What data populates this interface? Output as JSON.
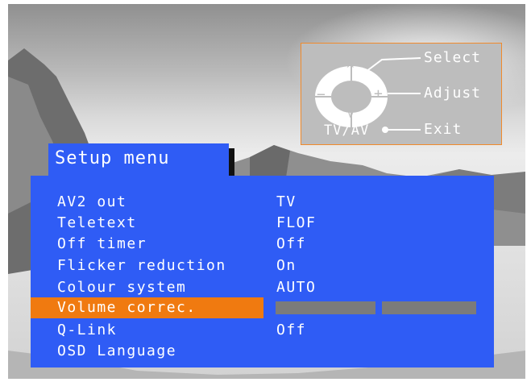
{
  "remote_hint": {
    "select_label": "Select",
    "adjust_label": "Adjust",
    "exit_label": "Exit",
    "tvav_label": "TV/AV",
    "up_symbol": "^",
    "down_symbol": "v",
    "minus_symbol": "−",
    "plus_symbol": "+"
  },
  "menu": {
    "title": "Setup menu",
    "items": [
      {
        "label": "AV2 out",
        "value": "TV"
      },
      {
        "label": "Teletext",
        "value": "FLOF"
      },
      {
        "label": "Off timer",
        "value": "Off"
      },
      {
        "label": "Flicker reduction",
        "value": "On"
      },
      {
        "label": "Colour system",
        "value": "AUTO"
      },
      {
        "label": "Volume correc.",
        "value": "",
        "selected": true,
        "level_bar": true
      },
      {
        "label": "Q-Link",
        "value": "Off"
      },
      {
        "label": "OSD Language",
        "value": ""
      }
    ]
  },
  "colors": {
    "menu_blue": "#2f5cf5",
    "highlight_orange": "#f07a10",
    "panel_gray": "#bdbdbd"
  }
}
